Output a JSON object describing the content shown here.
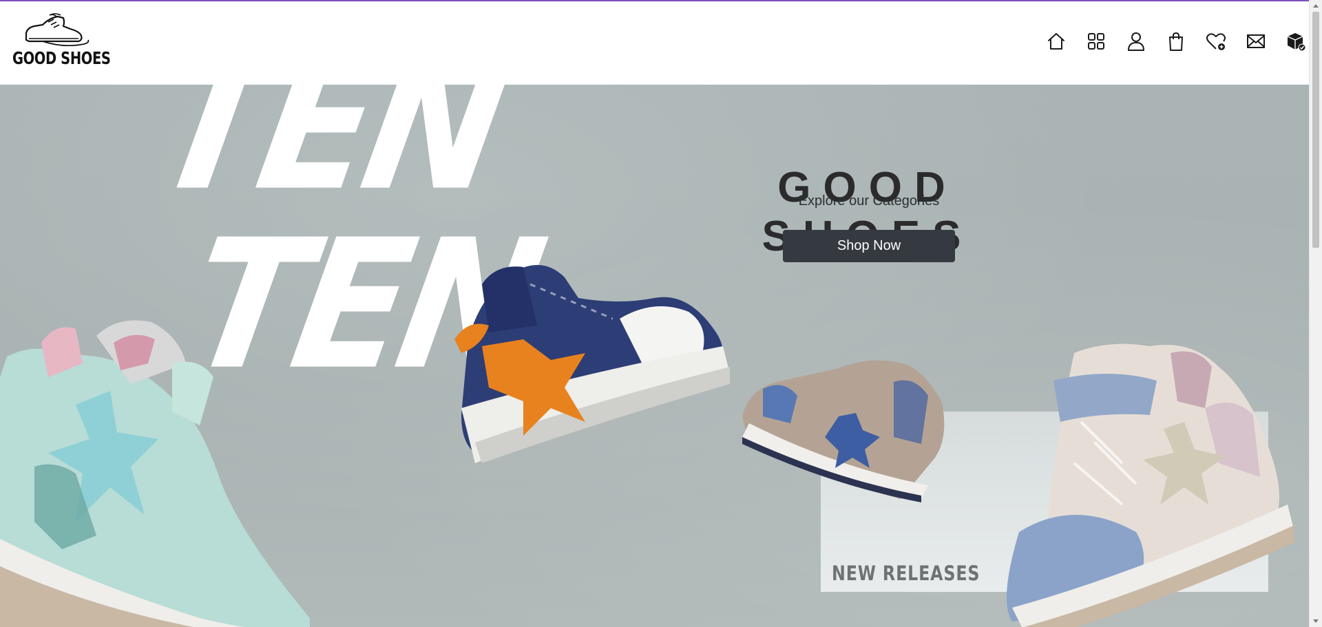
{
  "brand": {
    "logo_text": "GOOD SHOES",
    "icon": "sneaker-logo-icon"
  },
  "nav": {
    "icons": [
      {
        "name": "home-icon",
        "label": "Home"
      },
      {
        "name": "categories-grid-icon",
        "label": "Categories"
      },
      {
        "name": "user-account-icon",
        "label": "Account"
      },
      {
        "name": "shopping-bag-icon",
        "label": "Cart"
      },
      {
        "name": "wishlist-heart-icon",
        "label": "Wishlist"
      },
      {
        "name": "mail-icon",
        "label": "Contact"
      },
      {
        "name": "orders-box-icon",
        "label": "Orders"
      }
    ]
  },
  "hero": {
    "background_text": "TEN",
    "title": "GOOD SHOES",
    "subtitle": "Explore our Categories",
    "cta_label": "Shop Now",
    "promo_label": "NEW RELEASES"
  },
  "colors": {
    "accent_bar": "#7c4dbe",
    "hero_bg": "#aab4b4",
    "button_bg": "#343a40",
    "title_text": "#2b2b2b"
  }
}
